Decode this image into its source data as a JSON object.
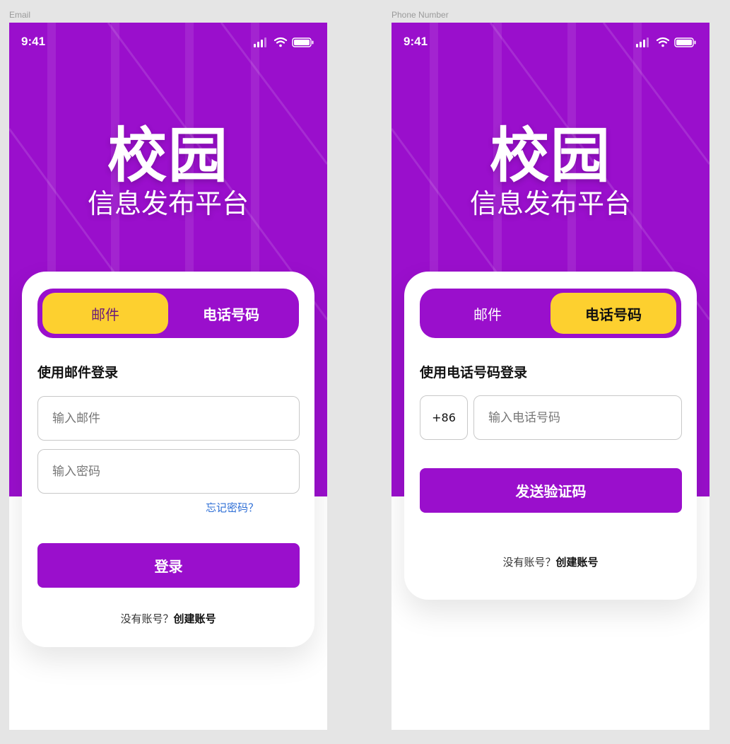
{
  "frames": [
    {
      "label": "Email",
      "status_time": "9:41",
      "hero_title": "校园",
      "hero_subtitle": "信息发布平台",
      "tabs": {
        "email": "邮件",
        "phone": "电话号码",
        "active": "email"
      },
      "section_title": "使用邮件登录",
      "email_input": {
        "placeholder": "输入邮件",
        "value": ""
      },
      "password_input": {
        "placeholder": "输入密码",
        "value": ""
      },
      "forgot_password": "忘记密码？",
      "login_button": "登录",
      "signup_prompt": "没有账号？",
      "signup_link": "创建账号"
    },
    {
      "label": "Phone Number",
      "status_time": "9:41",
      "hero_title": "校园",
      "hero_subtitle": "信息发布平台",
      "tabs": {
        "email": "邮件",
        "phone": "电话号码",
        "active": "phone"
      },
      "section_title": "使用电话号码登录",
      "country_code": "+86",
      "phone_input": {
        "placeholder": "输入电话号码",
        "value": ""
      },
      "send_code_button": "发送验证码",
      "signup_prompt": "没有账号？",
      "signup_link": "创建账号"
    }
  ],
  "colors": {
    "brand_purple": "#9a0fcc",
    "accent_yellow": "#fdd02f",
    "link_blue": "#2f6fd6",
    "page_background": "#e5e5e5"
  },
  "icons": [
    "cellular-signal-icon",
    "wifi-icon",
    "battery-icon"
  ]
}
